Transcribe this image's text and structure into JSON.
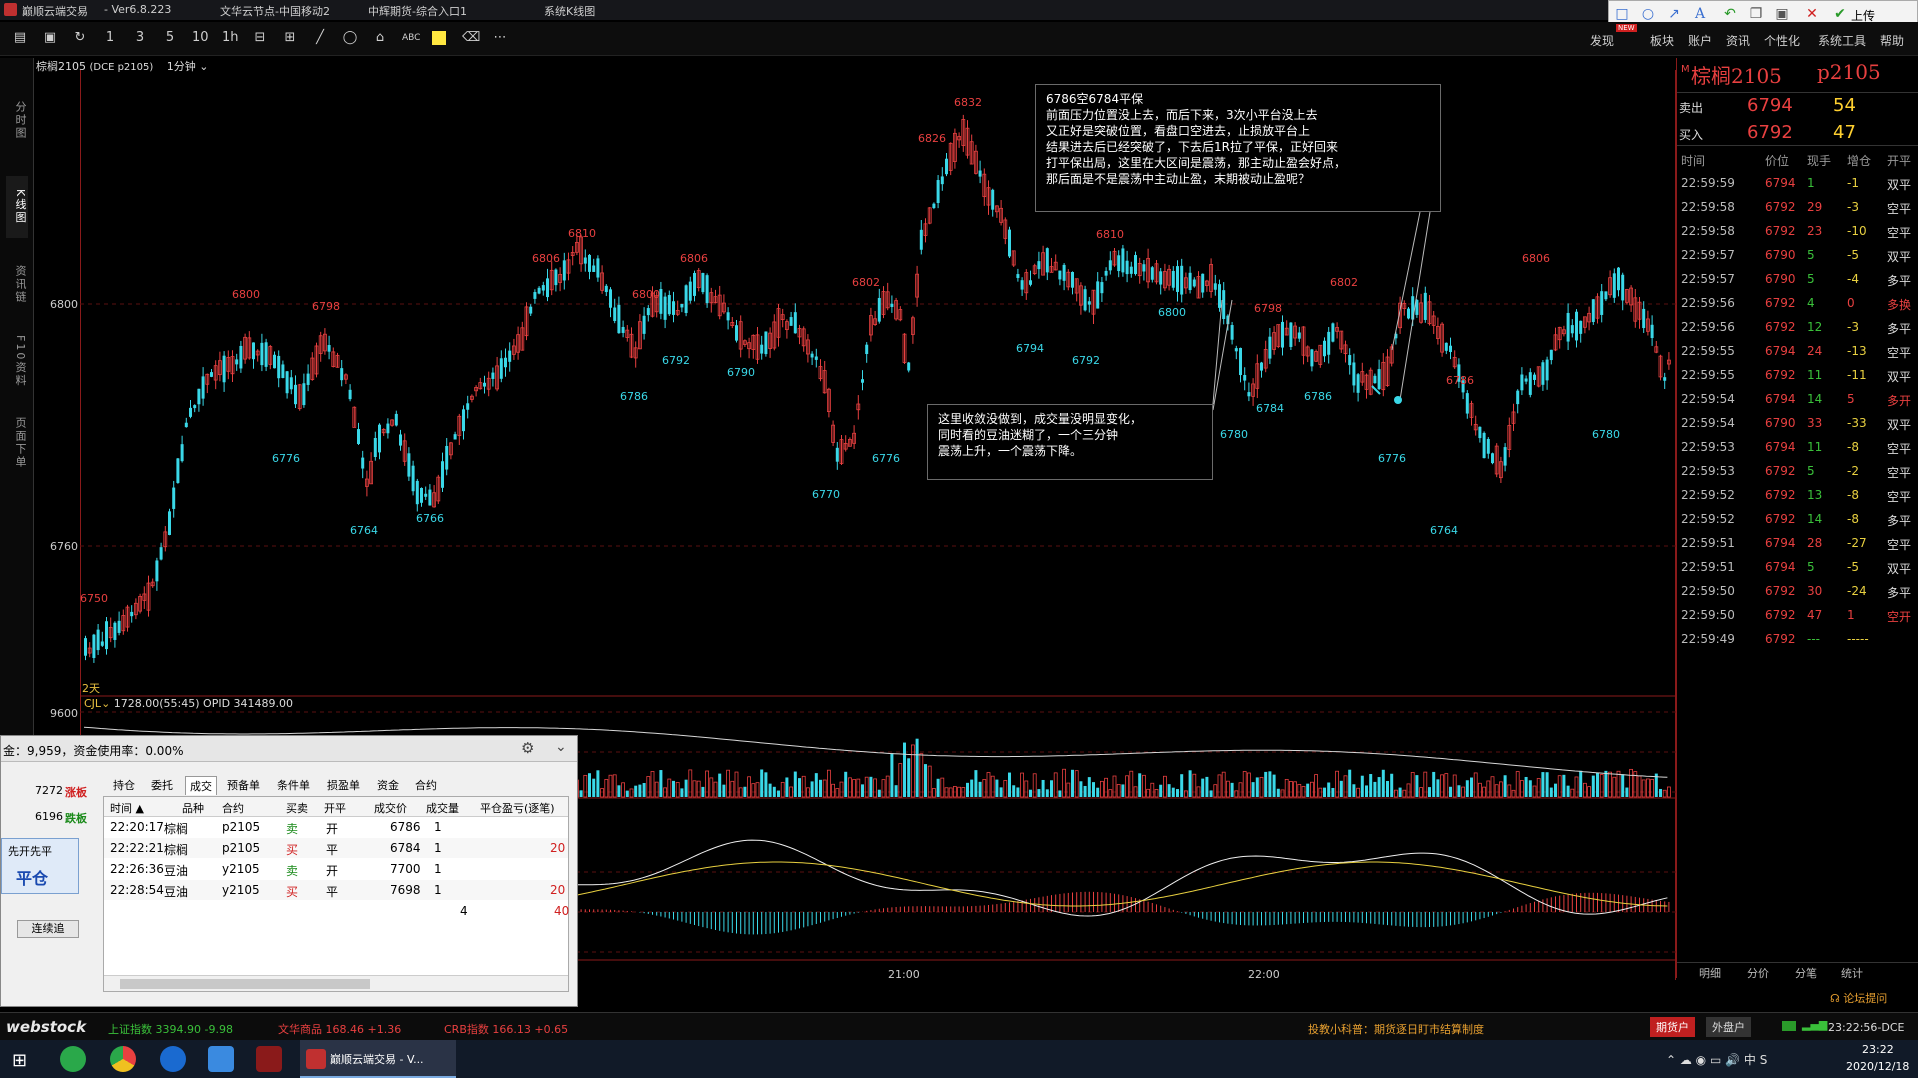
{
  "window": {
    "app_title": "巅顺云端交易",
    "version": "- Ver6.8.223",
    "server": "文华云节点-中国移动2",
    "entry": "中辉期货-综合入口1",
    "view": "系统K线图"
  },
  "menu": {
    "items": [
      "发现",
      "板块",
      "账户",
      "资讯",
      "个性化",
      "系统工具",
      "帮助"
    ],
    "new_badge": "NEW",
    "upload_label": "上传"
  },
  "chart": {
    "header_symbol": "棕榈2105",
    "header_exchange": "(DCE p2105)",
    "header_period": "1分钟",
    "days_label": "2天",
    "price_axis": [
      "6800",
      "6760",
      "9600"
    ],
    "time_axis": [
      "21:00",
      "22:00"
    ],
    "volume_header": "1728.00(55:45)  OPID 341489.00",
    "volume_label": "CJL",
    "high_labels": [
      {
        "t": "6750",
        "c": "#e84040"
      },
      {
        "t": "6800",
        "c": "#e84040"
      },
      {
        "t": "6798",
        "c": "#e84040"
      },
      {
        "t": "6806",
        "c": "#e84040"
      },
      {
        "t": "6810",
        "c": "#e84040"
      },
      {
        "t": "6800",
        "c": "#e84040"
      },
      {
        "t": "6806",
        "c": "#e84040"
      },
      {
        "t": "6802",
        "c": "#e84040"
      },
      {
        "t": "6826",
        "c": "#e84040"
      },
      {
        "t": "6832",
        "c": "#e84040"
      },
      {
        "t": "6810",
        "c": "#e84040"
      },
      {
        "t": "6798",
        "c": "#e84040"
      },
      {
        "t": "6802",
        "c": "#e84040"
      },
      {
        "t": "6786",
        "c": "#e84040"
      },
      {
        "t": "6806",
        "c": "#e84040"
      }
    ],
    "low_labels": [
      {
        "t": "6776"
      },
      {
        "t": "6764"
      },
      {
        "t": "6766"
      },
      {
        "t": "6786"
      },
      {
        "t": "6792"
      },
      {
        "t": "6790"
      },
      {
        "t": "6770"
      },
      {
        "t": "6776"
      },
      {
        "t": "6794"
      },
      {
        "t": "6792"
      },
      {
        "t": "6800"
      },
      {
        "t": "6780"
      },
      {
        "t": "6784"
      },
      {
        "t": "6786"
      },
      {
        "t": "6776"
      },
      {
        "t": "6764"
      },
      {
        "t": "6780"
      }
    ]
  },
  "notes": {
    "top": [
      "6786空6784平保",
      "前面压力位置没上去，而后下来，3次小平台没上去",
      "又正好是突破位置，看盘口空进去，止损放平台上",
      "结果进去后已经突破了，下去后1R拉了平保，正好回来",
      "打平保出局，这里在大区间是震荡，那主动止盈会好点，",
      "那后面是不是震荡中主动止盈，末期被动止盈呢？"
    ],
    "bottom": [
      "这里收敛没做到，成交量没明显变化，",
      "同时看的豆油迷糊了，一个三分钟",
      "震荡上升，一个震荡下降。"
    ]
  },
  "quote": {
    "symbol": "棕榈2105",
    "code": "p2105",
    "sell_label": "卖出",
    "sell_price": "6794",
    "sell_vol": "54",
    "buy_label": "买入",
    "buy_price": "6792",
    "buy_vol": "47",
    "columns": [
      "时间",
      "价位",
      "现手",
      "增仓",
      "开平"
    ],
    "ticks": [
      [
        "22:59:59",
        "6794",
        "1",
        "-1",
        "双平"
      ],
      [
        "22:59:58",
        "6792",
        "29",
        "-3",
        "空平"
      ],
      [
        "22:59:58",
        "6792",
        "23",
        "-10",
        "空平"
      ],
      [
        "22:59:57",
        "6790",
        "5",
        "-5",
        "双平"
      ],
      [
        "22:59:57",
        "6790",
        "5",
        "-4",
        "多平"
      ],
      [
        "22:59:56",
        "6792",
        "4",
        "0",
        "多换"
      ],
      [
        "22:59:56",
        "6792",
        "12",
        "-3",
        "多平"
      ],
      [
        "22:59:55",
        "6794",
        "24",
        "-13",
        "空平"
      ],
      [
        "22:59:55",
        "6792",
        "11",
        "-11",
        "双平"
      ],
      [
        "22:59:54",
        "6794",
        "14",
        "5",
        "多开"
      ],
      [
        "22:59:54",
        "6790",
        "33",
        "-33",
        "双平"
      ],
      [
        "22:59:53",
        "6794",
        "11",
        "-8",
        "空平"
      ],
      [
        "22:59:53",
        "6792",
        "5",
        "-2",
        "空平"
      ],
      [
        "22:59:52",
        "6792",
        "13",
        "-8",
        "空平"
      ],
      [
        "22:59:52",
        "6792",
        "14",
        "-8",
        "多平"
      ],
      [
        "22:59:51",
        "6794",
        "28",
        "-27",
        "空平"
      ],
      [
        "22:59:51",
        "6794",
        "5",
        "-5",
        "双平"
      ],
      [
        "22:59:50",
        "6792",
        "30",
        "-24",
        "多平"
      ],
      [
        "22:59:50",
        "6792",
        "47",
        "1",
        "空开"
      ],
      [
        "22:59:49",
        "6792",
        "---",
        "-----",
        ""
      ]
    ],
    "bottom_tabs": [
      "明细",
      "分价",
      "分笔",
      "统计"
    ],
    "forum": "论坛提问"
  },
  "trade": {
    "header": "金：9,959，资金使用率：0.00%",
    "left_prices": [
      {
        "v": "7272",
        "l": "涨板"
      },
      {
        "v": "6196",
        "l": "跌板"
      }
    ],
    "mode_label": "先开先平",
    "close_button": "平仓",
    "chase_button": "连续追",
    "tabs": [
      "持仓",
      "委托",
      "成交",
      "预备单",
      "条件单",
      "损盈单",
      "资金",
      "合约"
    ],
    "columns": [
      "时间 ▲",
      "品种",
      "合约",
      "买卖",
      "开平",
      "成交价",
      "成交量",
      "平仓盈亏(逐笔)"
    ],
    "rows": [
      [
        "22:20:17",
        "棕榈",
        "p2105",
        "卖",
        "开",
        "6786",
        "1",
        ""
      ],
      [
        "22:22:21",
        "棕榈",
        "p2105",
        "买",
        "平",
        "6784",
        "1",
        "20"
      ],
      [
        "22:26:36",
        "豆油",
        "y2105",
        "卖",
        "开",
        "7700",
        "1",
        ""
      ],
      [
        "22:28:54",
        "豆油",
        "y2105",
        "买",
        "平",
        "7698",
        "1",
        "20"
      ]
    ],
    "total_qty": "4",
    "total_pnl": "40"
  },
  "status": {
    "brand": "webstock",
    "index1": "上证指数  3394.90  -9.98",
    "index2": "文华商品  168.46  +1.36",
    "index3": "CRB指数  166.13  +0.65",
    "notice": "投教小科普：期货逐日盯市结算制度",
    "btn1": "期货户",
    "btn2": "外盘户",
    "clock": "23:22:56-DCE"
  },
  "taskbar": {
    "app": "巅顺云端交易 - V...",
    "time": "23:22",
    "date": "2020/12/18"
  }
}
